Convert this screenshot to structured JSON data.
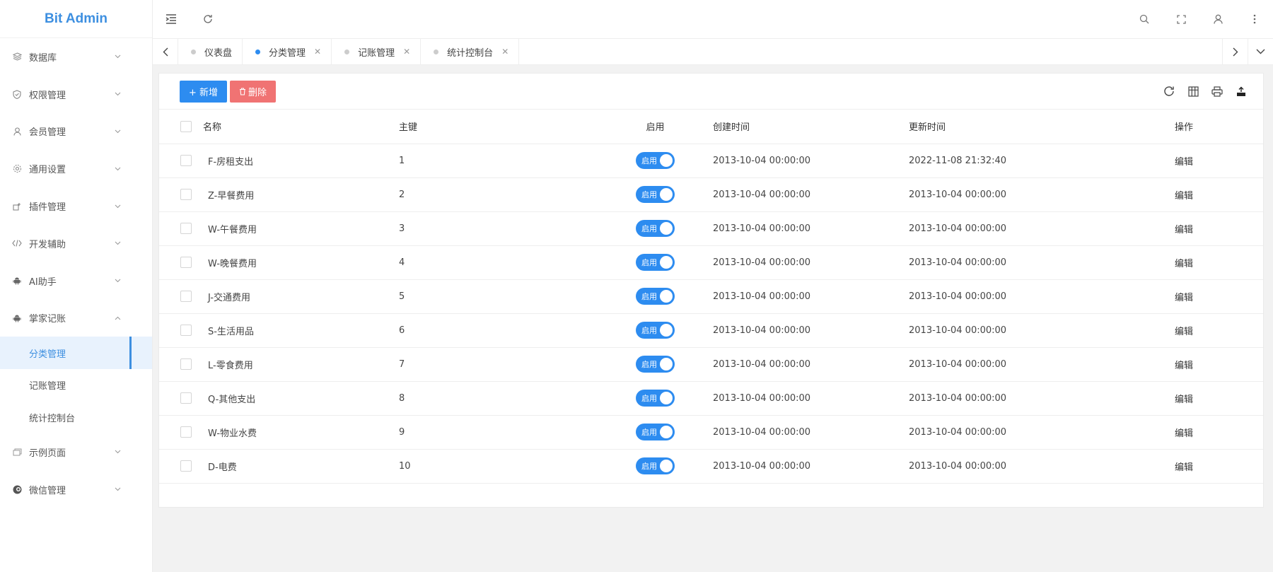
{
  "app": {
    "title": "Bit Admin"
  },
  "sidebar": {
    "items": [
      {
        "label": "数据库",
        "icon": "database-icon",
        "expanded": false
      },
      {
        "label": "权限管理",
        "icon": "shield-icon",
        "expanded": false
      },
      {
        "label": "会员管理",
        "icon": "user-icon",
        "expanded": false
      },
      {
        "label": "通用设置",
        "icon": "gear-icon",
        "expanded": false
      },
      {
        "label": "插件管理",
        "icon": "plugin-icon",
        "expanded": false
      },
      {
        "label": "开发辅助",
        "icon": "code-icon",
        "expanded": false
      },
      {
        "label": "AI助手",
        "icon": "android-icon",
        "expanded": false
      },
      {
        "label": "掌家记账",
        "icon": "android-icon",
        "expanded": true,
        "children": [
          {
            "label": "分类管理",
            "active": true
          },
          {
            "label": "记账管理",
            "active": false
          },
          {
            "label": "统计控制台",
            "active": false
          }
        ]
      },
      {
        "label": "示例页面",
        "icon": "pages-icon",
        "expanded": false
      },
      {
        "label": "微信管理",
        "icon": "wechat-icon",
        "expanded": false
      }
    ]
  },
  "header": {
    "left_icons": [
      "menu-fold-icon",
      "refresh-icon"
    ],
    "right_icons": [
      "search-icon",
      "fullscreen-icon",
      "user-icon",
      "more-icon"
    ]
  },
  "tabs": [
    {
      "label": "仪表盘",
      "active": false,
      "closable": false
    },
    {
      "label": "分类管理",
      "active": true,
      "closable": true
    },
    {
      "label": "记账管理",
      "active": false,
      "closable": true
    },
    {
      "label": "统计控制台",
      "active": false,
      "closable": true
    }
  ],
  "toolbar": {
    "add_label": "+ 新增",
    "delete_label": "删除",
    "right_icons": [
      "refresh-icon",
      "columns-icon",
      "print-icon",
      "export-icon"
    ]
  },
  "table": {
    "columns": [
      "名称",
      "主键",
      "启用",
      "创建时间",
      "更新时间",
      "操作"
    ],
    "switch_label": "启用",
    "action_label": "编辑",
    "rows": [
      {
        "name": "F-房租支出",
        "id": "1",
        "created": "2013-10-04 00:00:00",
        "updated": "2022-11-08 21:32:40"
      },
      {
        "name": "Z-早餐费用",
        "id": "2",
        "created": "2013-10-04 00:00:00",
        "updated": "2013-10-04 00:00:00"
      },
      {
        "name": "W-午餐费用",
        "id": "3",
        "created": "2013-10-04 00:00:00",
        "updated": "2013-10-04 00:00:00"
      },
      {
        "name": "W-晚餐费用",
        "id": "4",
        "created": "2013-10-04 00:00:00",
        "updated": "2013-10-04 00:00:00"
      },
      {
        "name": "J-交通费用",
        "id": "5",
        "created": "2013-10-04 00:00:00",
        "updated": "2013-10-04 00:00:00"
      },
      {
        "name": "S-生活用品",
        "id": "6",
        "created": "2013-10-04 00:00:00",
        "updated": "2013-10-04 00:00:00"
      },
      {
        "name": "L-零食费用",
        "id": "7",
        "created": "2013-10-04 00:00:00",
        "updated": "2013-10-04 00:00:00"
      },
      {
        "name": "Q-其他支出",
        "id": "8",
        "created": "2013-10-04 00:00:00",
        "updated": "2013-10-04 00:00:00"
      },
      {
        "name": "W-物业水费",
        "id": "9",
        "created": "2013-10-04 00:00:00",
        "updated": "2013-10-04 00:00:00"
      },
      {
        "name": "D-电费",
        "id": "10",
        "created": "2013-10-04 00:00:00",
        "updated": "2013-10-04 00:00:00"
      }
    ]
  },
  "colors": {
    "accent": "#2d8cf0",
    "danger": "#f07373",
    "logo": "#3d8fe0"
  }
}
